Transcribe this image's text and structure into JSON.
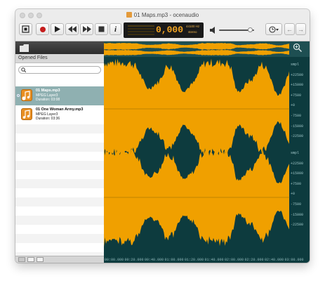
{
  "window": {
    "title": "01 Maps.mp3 - ocenaudio"
  },
  "toolbar": {
    "buttons": [
      {
        "name": "record-monitor-button",
        "icon": "stop-square-icon"
      },
      {
        "name": "record-button",
        "icon": "record-circle-icon"
      },
      {
        "name": "play-button",
        "icon": "play-icon"
      },
      {
        "name": "rewind-button",
        "icon": "rewind-icon"
      },
      {
        "name": "fast-forward-button",
        "icon": "fast-forward-icon"
      },
      {
        "name": "stop-button",
        "icon": "stop-icon"
      },
      {
        "name": "info-button",
        "icon": "info-icon",
        "label": "i"
      }
    ],
    "time_display": "0,000",
    "sample_rate": "44100 Hz",
    "channels": "stereo",
    "volume_level": 0.88
  },
  "sidebar": {
    "header": "Opened Files",
    "search_placeholder": "",
    "files": [
      {
        "name": "01 Maps.mp3",
        "format": "MPEG Layer3",
        "duration": "Duration: 03:08",
        "selected": true
      },
      {
        "name": "01 One Woman Army.mp3",
        "format": "MPEG Layer3",
        "duration": "Duration: 03:36",
        "selected": false
      }
    ]
  },
  "waveform": {
    "amp_labels": [
      "smpl",
      "+22500",
      "+15000",
      "+7500",
      "+0",
      "-7500",
      "-15000",
      "-22500"
    ],
    "time_labels": [
      "00:00.000",
      "00:20.000",
      "00:40.000",
      "01:00.000",
      "01:20.000",
      "01:40.000",
      "02:00.000",
      "02:20.000",
      "02:40.000",
      "03:00.000"
    ]
  },
  "colors": {
    "wave": "#f0a000",
    "background": "#0d3b3e",
    "selection": "#8fb0b1"
  }
}
